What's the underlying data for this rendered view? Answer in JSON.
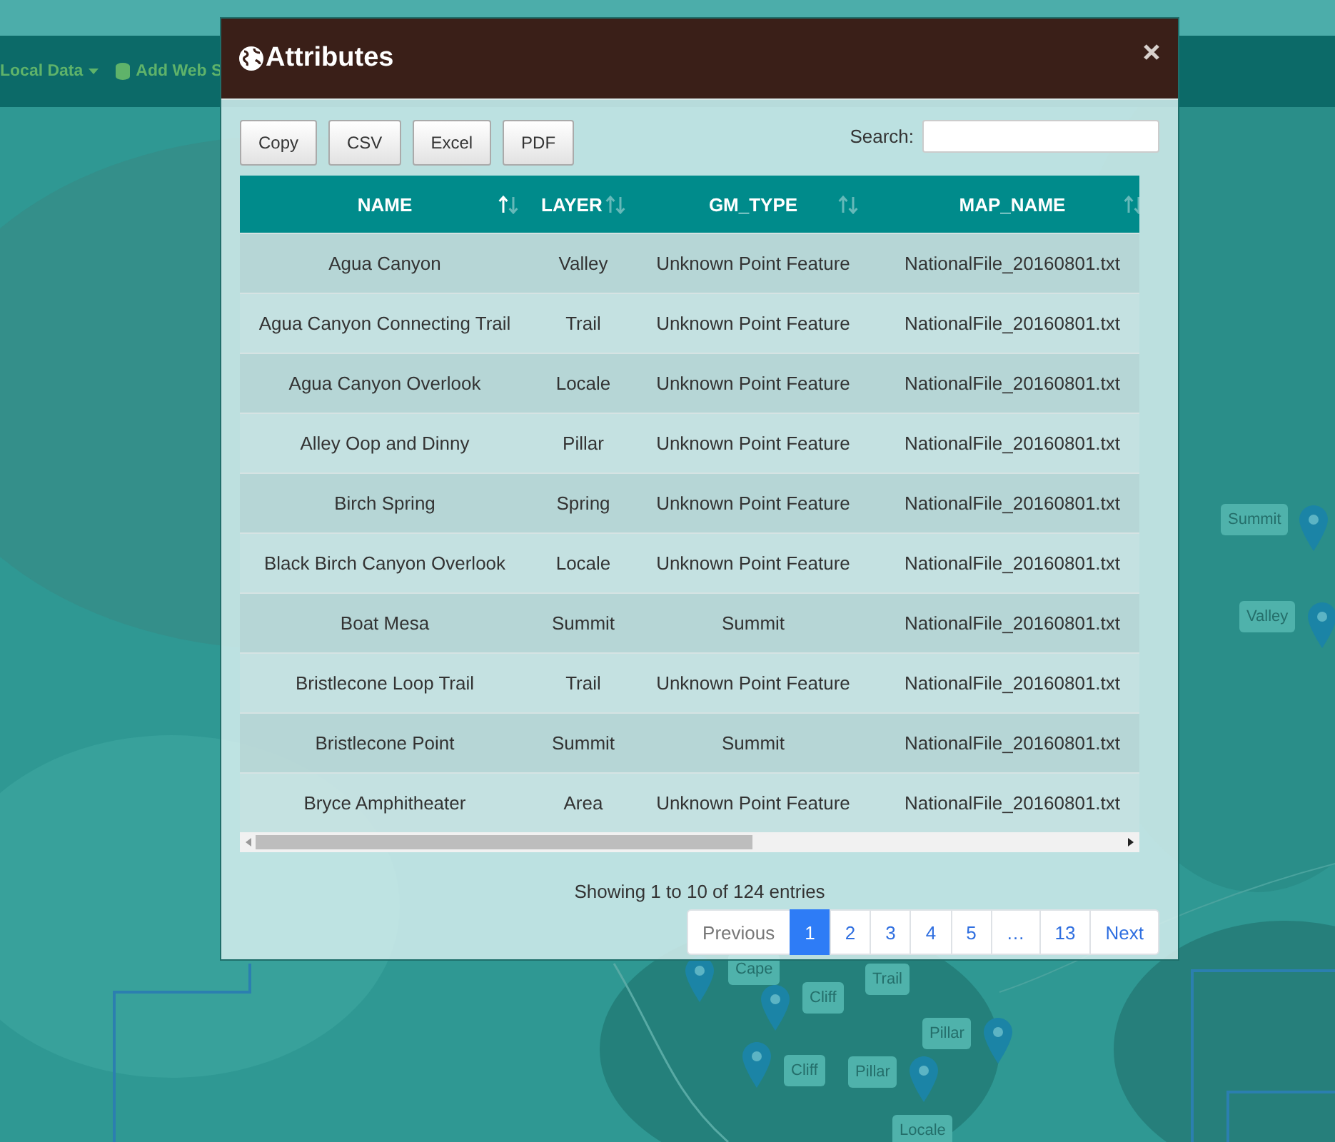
{
  "navbar": {
    "items": [
      {
        "label": "Local Data",
        "caret": true
      },
      {
        "label": "Add Web S",
        "caret": false
      }
    ]
  },
  "map": {
    "markers": [
      {
        "label": "Summit",
        "pin": true
      },
      {
        "label": "Valley",
        "pin": true
      },
      {
        "label": "Cape",
        "pin": true
      },
      {
        "label": "Trail",
        "pin": false
      },
      {
        "label": "Cliff",
        "pin": true
      },
      {
        "label": "Pillar",
        "pin": true
      },
      {
        "label": "Cliff",
        "pin": true
      },
      {
        "label": "Pillar",
        "pin": true
      },
      {
        "label": "Locale",
        "pin": false
      }
    ]
  },
  "modal": {
    "title": "Attributes",
    "buttons": [
      "Copy",
      "CSV",
      "Excel",
      "PDF"
    ],
    "search": {
      "label": "Search:"
    },
    "table": {
      "columns": [
        {
          "label": "NAME",
          "sorted": true
        },
        {
          "label": "LAYER",
          "sorted": false
        },
        {
          "label": "GM_TYPE",
          "sorted": false
        },
        {
          "label": "MAP_NAME",
          "sorted": false
        }
      ],
      "rows": [
        [
          "Agua Canyon",
          "Valley",
          "Unknown Point Feature",
          "NationalFile_20160801.txt"
        ],
        [
          "Agua Canyon Connecting Trail",
          "Trail",
          "Unknown Point Feature",
          "NationalFile_20160801.txt"
        ],
        [
          "Agua Canyon Overlook",
          "Locale",
          "Unknown Point Feature",
          "NationalFile_20160801.txt"
        ],
        [
          "Alley Oop and Dinny",
          "Pillar",
          "Unknown Point Feature",
          "NationalFile_20160801.txt"
        ],
        [
          "Birch Spring",
          "Spring",
          "Unknown Point Feature",
          "NationalFile_20160801.txt"
        ],
        [
          "Black Birch Canyon Overlook",
          "Locale",
          "Unknown Point Feature",
          "NationalFile_20160801.txt"
        ],
        [
          "Boat Mesa",
          "Summit",
          "Summit",
          "NationalFile_20160801.txt"
        ],
        [
          "Bristlecone Loop Trail",
          "Trail",
          "Unknown Point Feature",
          "NationalFile_20160801.txt"
        ],
        [
          "Bristlecone Point",
          "Summit",
          "Summit",
          "NationalFile_20160801.txt"
        ],
        [
          "Bryce Amphitheater",
          "Area",
          "Unknown Point Feature",
          "NationalFile_20160801.txt"
        ]
      ]
    },
    "info": "Showing 1 to 10 of 124 entries",
    "pagination": [
      {
        "label": "Previous",
        "selected": false,
        "disabled": true
      },
      {
        "label": "1",
        "selected": true,
        "disabled": false
      },
      {
        "label": "2",
        "selected": false,
        "disabled": false
      },
      {
        "label": "3",
        "selected": false,
        "disabled": false
      },
      {
        "label": "4",
        "selected": false,
        "disabled": false
      },
      {
        "label": "5",
        "selected": false,
        "disabled": false
      },
      {
        "label": "…",
        "selected": false,
        "disabled": false
      },
      {
        "label": "13",
        "selected": false,
        "disabled": false
      },
      {
        "label": "Next",
        "selected": false,
        "disabled": false
      }
    ]
  }
}
